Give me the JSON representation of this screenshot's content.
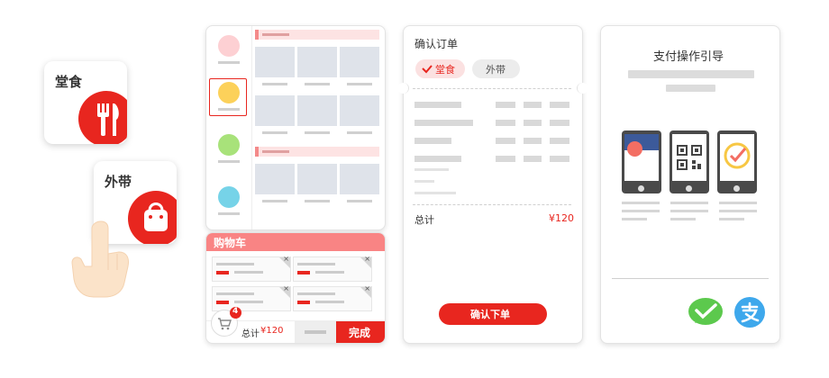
{
  "dine_in_card": {
    "label": "堂食"
  },
  "takeaway_card": {
    "label": "外带"
  },
  "cart": {
    "title": "购物车",
    "badge_count": "4",
    "total_label": "总计",
    "total_value": "¥120",
    "done_label": "完成"
  },
  "order": {
    "title": "确认订单",
    "tab_dine_in": "堂食",
    "tab_takeaway": "外带",
    "total_label": "总计",
    "total_value": "¥120",
    "submit_label": "确认下单"
  },
  "payment": {
    "title": "支付操作引导"
  },
  "colors": {
    "accent": "#e8261f",
    "cart_header": "#f98484",
    "wechat": "#5cc94d",
    "alipay": "#3ea8ec"
  },
  "icons": [
    "fork-knife-icon",
    "shopping-bag-icon",
    "hand-pointer-icon",
    "cart-icon",
    "check-icon",
    "qr-code-icon",
    "wechat-pay-icon",
    "alipay-icon"
  ]
}
